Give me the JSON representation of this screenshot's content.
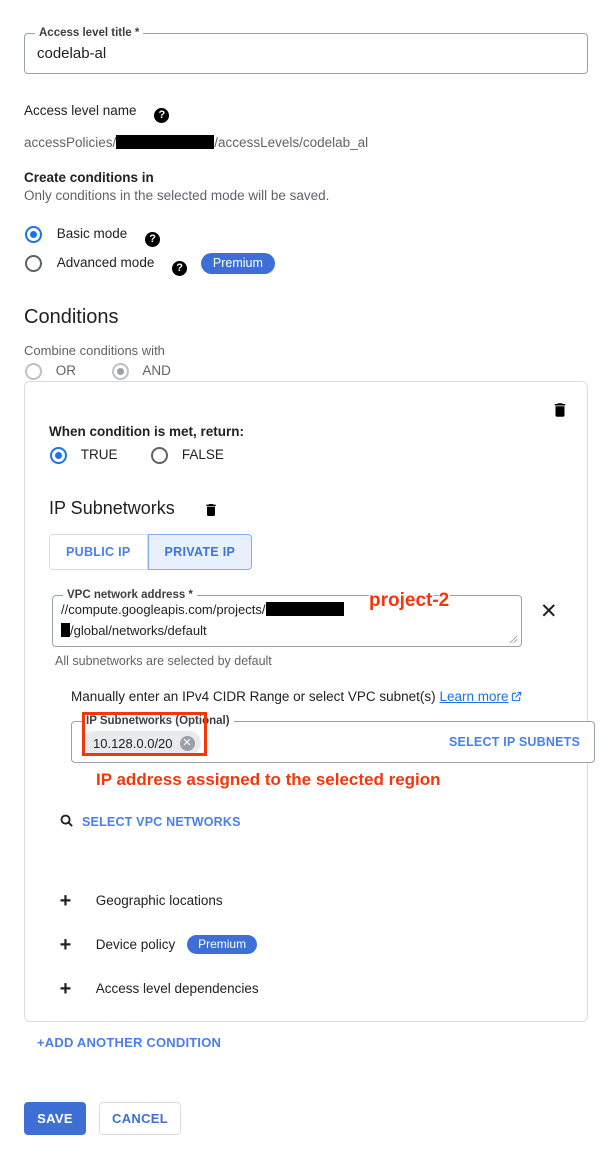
{
  "form": {
    "title_field": {
      "legend": "Access level title *",
      "value": "codelab-al"
    },
    "access_level_name": {
      "label": "Access level name",
      "help_icon": "help-icon",
      "value_prefix": "accessPolicies/",
      "value_suffix": "/accessLevels/codelab_al",
      "redacted": true
    },
    "create_conditions": {
      "label": "Create conditions in",
      "sublabel": "Only conditions in the selected mode will be saved."
    },
    "modes": [
      {
        "label": "Basic mode",
        "selected": true,
        "help_icon": "help-icon",
        "badge": ""
      },
      {
        "label": "Advanced mode",
        "selected": false,
        "help_icon": "help-icon",
        "badge": "Premium"
      }
    ]
  },
  "conditions": {
    "heading": "Conditions",
    "combine_label": "Combine conditions with",
    "combine_options": [
      {
        "label": "OR",
        "selected": false
      },
      {
        "label": "AND",
        "selected": true
      }
    ],
    "card": {
      "delete_icon": "trash-icon",
      "when_label": "When condition is met, return:",
      "return_options": [
        {
          "label": "TRUE",
          "selected": true
        },
        {
          "label": "FALSE",
          "selected": false
        }
      ],
      "ip_subnetworks": {
        "heading": "IP Subnetworks",
        "delete_icon": "trash-icon",
        "toggle": [
          {
            "label": "PUBLIC IP",
            "selected": false
          },
          {
            "label": "PRIVATE IP",
            "selected": true
          }
        ],
        "vpc_field": {
          "legend": "VPC network address *",
          "line1_prefix": "//compute.googleapis.com/projects/",
          "line2_suffix": "/global/networks/default",
          "clear_icon": "close-icon",
          "hint": "All subnetworks are selected by default"
        },
        "manual_hint": "Manually enter an IPv4 CIDR Range or select VPC subnet(s)",
        "learn_more": "Learn more",
        "subnets_field": {
          "legend": "IP Subnetworks (Optional)",
          "chip": "10.128.0.0/20",
          "chip_remove_icon": "remove-chip-icon",
          "action": "SELECT IP SUBNETS"
        },
        "select_vpc_networks": "SELECT VPC NETWORKS",
        "search_icon": "search-icon"
      },
      "expandables": [
        {
          "label": "Geographic locations",
          "badge": ""
        },
        {
          "label": "Device policy",
          "badge": "Premium"
        },
        {
          "label": "Access level dependencies",
          "badge": ""
        }
      ]
    },
    "add_another": "+ADD ANOTHER CONDITION"
  },
  "footer": {
    "save_label": "SAVE",
    "cancel_label": "CANCEL"
  },
  "annotations": [
    {
      "name": "project-annotation",
      "text": "project-2"
    },
    {
      "name": "region-annotation",
      "text": "IP address assigned to the selected region"
    }
  ],
  "colors": {
    "accent_blue": "#3d6fd6",
    "link_blue": "#1a73e8",
    "annotation_red": "#f4360c",
    "selected_toggle_bg": "#e8f0fe"
  }
}
